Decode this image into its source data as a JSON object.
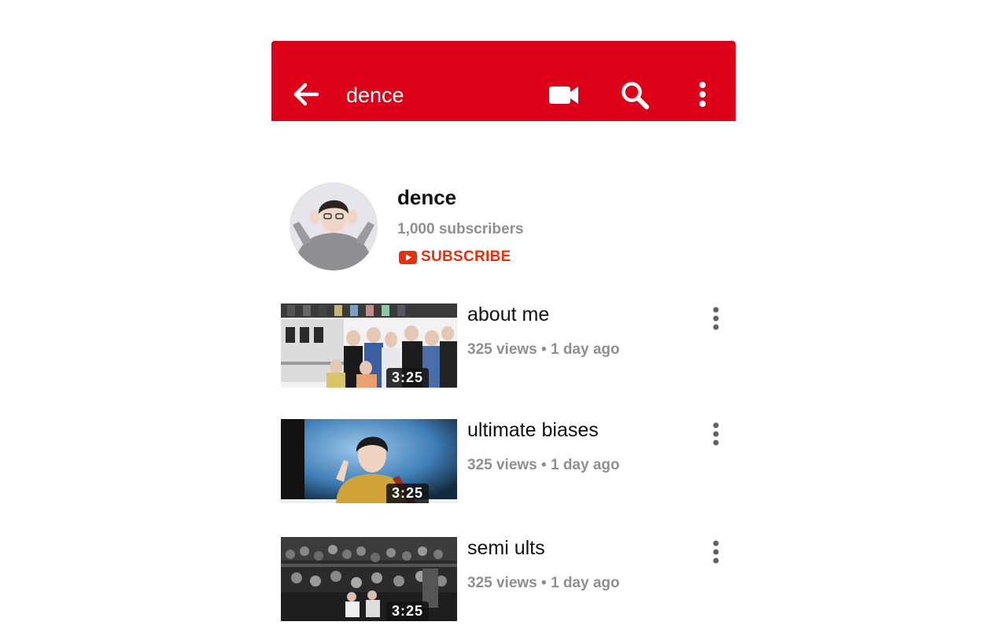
{
  "header": {
    "title": "dence",
    "icons": [
      "back-arrow-icon",
      "video-camera-icon",
      "search-icon",
      "more-vert-icon"
    ]
  },
  "channel": {
    "name": "dence",
    "subscribers": "1,000 subscribers",
    "subscribe_label": "SUBSCRIBE"
  },
  "videos": [
    {
      "title": "about me",
      "views": "325 views",
      "age": "1 day ago",
      "duration": "3:25"
    },
    {
      "title": "ultimate biases",
      "views": "325 views",
      "age": "1 day ago",
      "duration": "3:25"
    },
    {
      "title": "semi ults",
      "views": "325 views",
      "age": "1 day ago",
      "duration": "3:25"
    }
  ],
  "meta_separator": "•",
  "colors": {
    "appbar": "#dd0019",
    "subscribe": "#e8300f",
    "meta_text": "#8f8f8f"
  }
}
